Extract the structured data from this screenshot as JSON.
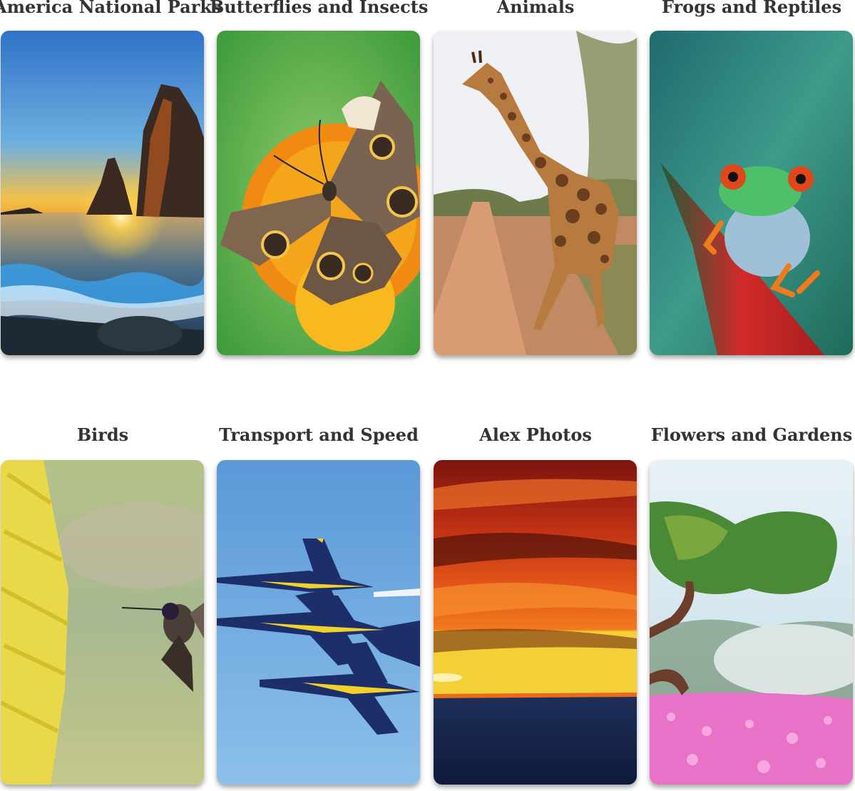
{
  "gallery": {
    "albums": [
      {
        "title": "America National Parks",
        "thumbnail": "sea-stack-sunset-image"
      },
      {
        "title": "Butterflies and Insects",
        "thumbnail": "butterfly-on-flower-image"
      },
      {
        "title": "Animals",
        "thumbnail": "giraffe-on-road-image"
      },
      {
        "title": "Frogs and Reptiles",
        "thumbnail": "tree-frog-image"
      },
      {
        "title": "Birds",
        "thumbnail": "hummingbird-image"
      },
      {
        "title": "Transport and Speed",
        "thumbnail": "jets-formation-image"
      },
      {
        "title": "Alex Photos",
        "thumbnail": "red-sunset-sea-image"
      },
      {
        "title": "Flowers and Gardens",
        "thumbnail": "tree-and-flower-field-image"
      }
    ]
  }
}
